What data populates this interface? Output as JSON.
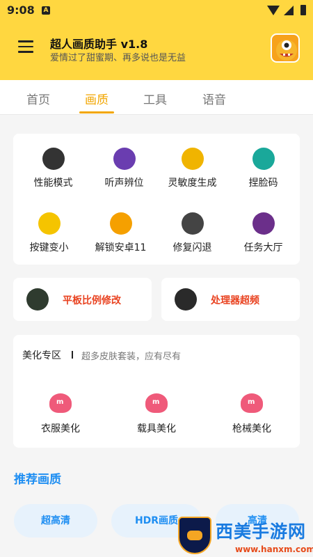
{
  "status": {
    "time": "9:08",
    "notification_icon": "a-icon"
  },
  "header": {
    "title": "超人画质助手 v1.8",
    "subtitle": "爱情过了甜蜜期、再多说也是无益",
    "menu_icon": "hamburger-icon",
    "avatar_icon": "monster-avatar-icon"
  },
  "tabs": [
    {
      "label": "首页",
      "active": false
    },
    {
      "label": "画质",
      "active": true
    },
    {
      "label": "工具",
      "active": false
    },
    {
      "label": "语音",
      "active": false
    }
  ],
  "tools": [
    {
      "label": "性能模式",
      "icon": "cherry-icon",
      "color": "#333333"
    },
    {
      "label": "听声辨位",
      "icon": "gameboy-icon",
      "color": "#6a3db0"
    },
    {
      "label": "灵敏度生成",
      "icon": "robot-icon",
      "color": "#f0b400"
    },
    {
      "label": "捏脸码",
      "icon": "potion-icon",
      "color": "#1aa89a"
    },
    {
      "label": "按键变小",
      "icon": "spider-icon",
      "color": "#f5c400"
    },
    {
      "label": "解锁安卓11",
      "icon": "phone-icon",
      "color": "#f5a000"
    },
    {
      "label": "修复闪退",
      "icon": "sushi-icon",
      "color": "#444444"
    },
    {
      "label": "任务大厅",
      "icon": "scroll-icon",
      "color": "#6b2f8a"
    }
  ],
  "wide_cards": [
    {
      "label": "平板比例修改",
      "icon": "plant-icon",
      "color": "#2f3b2f"
    },
    {
      "label": "处理器超频",
      "icon": "rocket-icon",
      "color": "#2a2a2a"
    }
  ],
  "beauty": {
    "title": "美化专区",
    "subtitle": "超多皮肤套装，应有尽有",
    "items": [
      {
        "label": "衣服美化",
        "icon": "heart-m-icon"
      },
      {
        "label": "载具美化",
        "icon": "heart-m-icon"
      },
      {
        "label": "枪械美化",
        "icon": "heart-m-icon"
      }
    ]
  },
  "recommended": {
    "title": "推荐画质",
    "options": [
      "超高清",
      "HDR画质",
      "高清"
    ]
  },
  "watermark": {
    "text": "西美手游网",
    "url": "www.hanxm.com"
  },
  "colors": {
    "header_bg": "#FFD740",
    "active_tab": "#f2a600",
    "accent_red": "#e94321",
    "accent_blue": "#1e8ef2",
    "beauty_pink": "#ef5a7a"
  }
}
